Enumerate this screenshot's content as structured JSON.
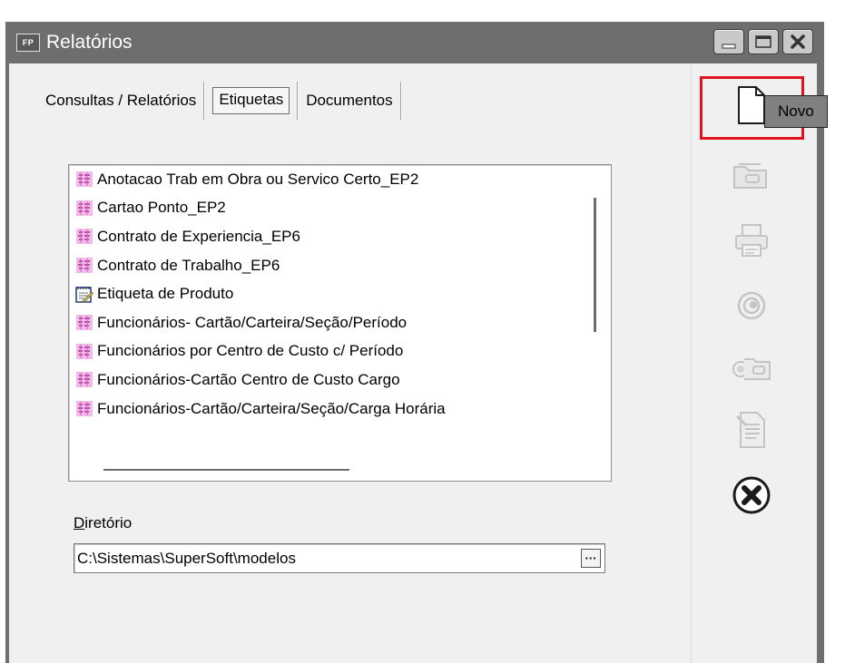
{
  "window": {
    "app_badge": "FP",
    "title": "Relatórios"
  },
  "tabs": [
    {
      "label": "Consultas / Relatórios",
      "active": false
    },
    {
      "label": "Etiquetas",
      "active": true
    },
    {
      "label": "Documentos",
      "active": false
    }
  ],
  "list": {
    "items": [
      {
        "label": "Anotacao Trab em Obra ou Servico Certo_EP2",
        "icon": "label-report-icon"
      },
      {
        "label": "Cartao Ponto_EP2",
        "icon": "label-report-icon"
      },
      {
        "label": "Contrato de Experiencia_EP6",
        "icon": "label-report-icon"
      },
      {
        "label": "Contrato de Trabalho_EP6",
        "icon": "label-report-icon"
      },
      {
        "label": "Etiqueta de Produto",
        "icon": "notepad-icon"
      },
      {
        "label": "Funcionários- Cartão/Carteira/Seção/Período",
        "icon": "label-report-icon"
      },
      {
        "label": "Funcionários por Centro de Custo  c/ Período",
        "icon": "label-report-icon"
      },
      {
        "label": "Funcionários-Cartão Centro de Custo Cargo",
        "icon": "label-report-icon"
      },
      {
        "label": "Funcionários-Cartão/Carteira/Seção/Carga Horária",
        "icon": "label-report-icon"
      }
    ]
  },
  "directory": {
    "label_accel": "D",
    "label_rest": "iretório",
    "value": "C:\\Sistemas\\SuperSoft\\modelos",
    "browse_label": "···"
  },
  "toolbar": {
    "tools": [
      "new-document-icon",
      "open-folder-icon",
      "printer-icon",
      "eye-icon",
      "preview-folder-icon",
      "report-document-icon",
      "close-circle-icon"
    ],
    "tooltip": "Novo"
  },
  "colors": {
    "titlebar": "#6e6e6e",
    "highlight": "#e0141e",
    "panel": "#f0f0f0",
    "disabled_icon": "#c4c4c4"
  }
}
